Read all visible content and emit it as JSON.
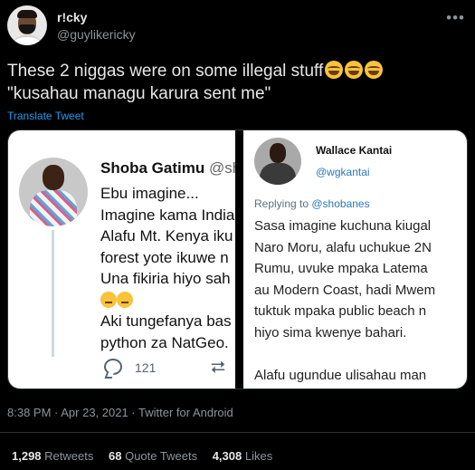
{
  "author": {
    "display_name": "r!cky",
    "handle": "@guylikericky"
  },
  "tweet": {
    "line1": "These 2 niggas were on some illegal stuff",
    "line2": "\"kusahau managu karura sent me\"",
    "emojis": [
      "face-with-tears-of-joy",
      "face-with-tears-of-joy",
      "face-with-tears-of-joy"
    ],
    "translate_label": "Translate Tweet"
  },
  "media": {
    "left": {
      "name": "Shoba Gatimu",
      "handle": "@sh",
      "lines": [
        "Ebu imagine...",
        "Imagine kama India",
        "Alafu Mt. Kenya iku",
        "forest yote ikuwe n",
        "Una fikiria hiyo sah",
        "",
        "Aki tungefanya bas",
        "python za NatGeo."
      ],
      "reply_count": "121"
    },
    "right": {
      "name": "Wallace Kantai",
      "handle": "@wgkantai",
      "replying_prefix": "Replying to ",
      "replying_to": "@shobanes",
      "lines": [
        "Sasa imagine kuchuna kiugal",
        "Naro Moru, alafu uchukue 2N",
        "Rumu, uvuke mpaka Latema",
        "au Modern Coast, hadi Mwem",
        "tuktuk mpaka public beach n",
        "hiyo sima kwenye bahari."
      ],
      "last_line": "Alafu ugundue ulisahau man"
    }
  },
  "timestamp": "8:38 PM · Apr 23, 2021 · Twitter for Android",
  "stats": {
    "retweets_count": "1,298",
    "retweets_label": "Retweets",
    "quotes_count": "68",
    "quotes_label": "Quote Tweets",
    "likes_count": "4,308",
    "likes_label": "Likes"
  },
  "colors": {
    "background": "#000000",
    "link": "#1d9bf0",
    "muted": "#8b949b"
  }
}
